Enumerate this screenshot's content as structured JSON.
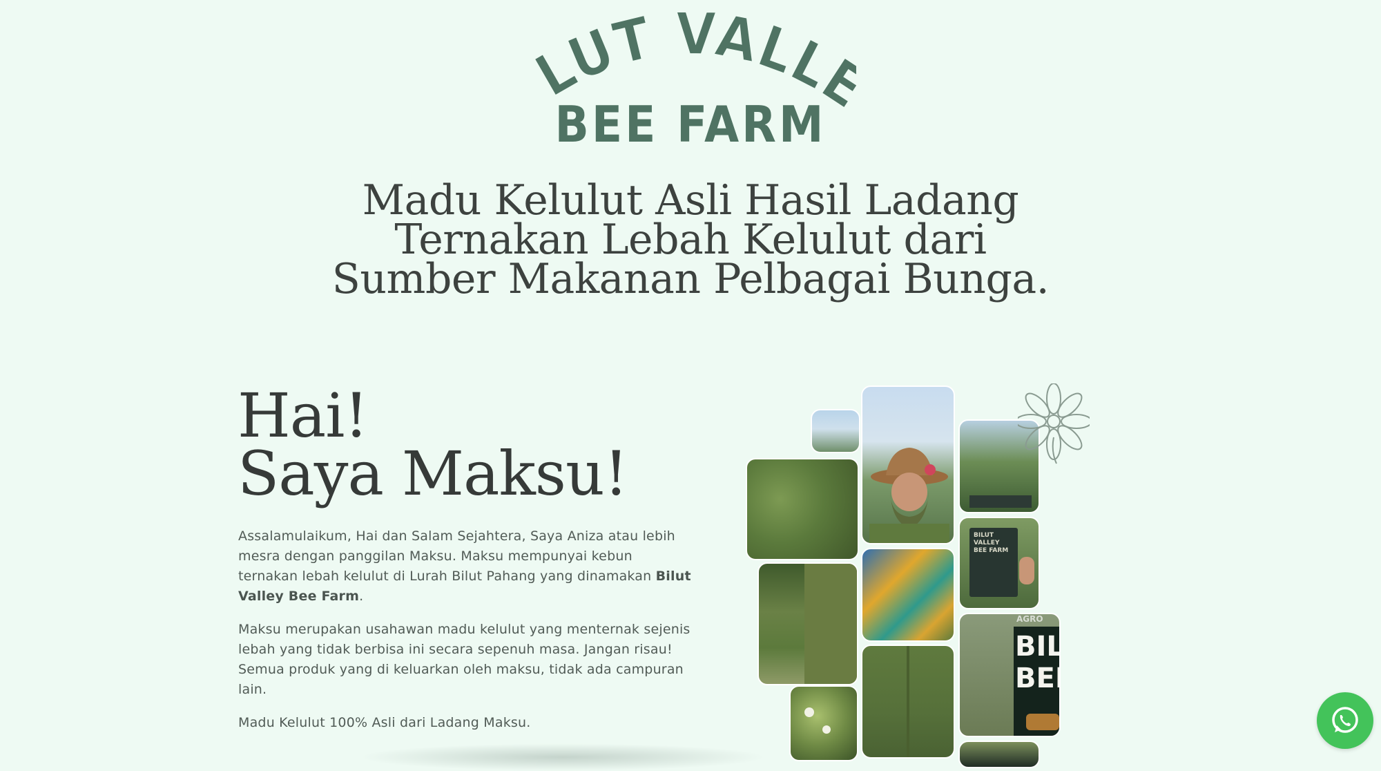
{
  "logo": {
    "line1": "BILUT VALLEY",
    "line2": "BEE FARM",
    "color": "#4f7363"
  },
  "hero": {
    "title_lines": [
      "Madu Kelulut Asli Hasil Ladang",
      "Ternakan Lebah Kelulut dari",
      "Sumber Makanan Pelbagai Bunga."
    ]
  },
  "intro": {
    "heading_lines": [
      "Hai!",
      "Saya Maksu!"
    ],
    "p1_text": "Assalamulaikum, Hai dan Salam Sejahtera, Saya Aniza atau lebih mesra dengan panggilan Maksu. Maksu mempunyai kebun ternakan lebah kelulut di Lurah Bilut Pahang yang dinamakan ",
    "p1_bold": "Bilut Valley Bee Farm",
    "p1_end": ".",
    "p2": "Maksu merupakan usahawan madu kelulut yang menternak sejenis lebah yang tidak berbisa ini secara sepenuh masa. Jangan risau! Semua produk yang di keluarkan oleh maksu, tidak ada campuran lain.",
    "p3": "Madu Kelulut 100% Asli dari Ladang Maksu."
  },
  "collage": {
    "sign_lines": [
      "BILUT",
      "BEE"
    ],
    "small_sign_lines": [
      "BILUT VALLEY",
      "BEE FARM"
    ],
    "agro_text": "AGRO"
  },
  "whatsapp": {
    "icon": "whatsapp-icon",
    "color": "#43c35a"
  }
}
